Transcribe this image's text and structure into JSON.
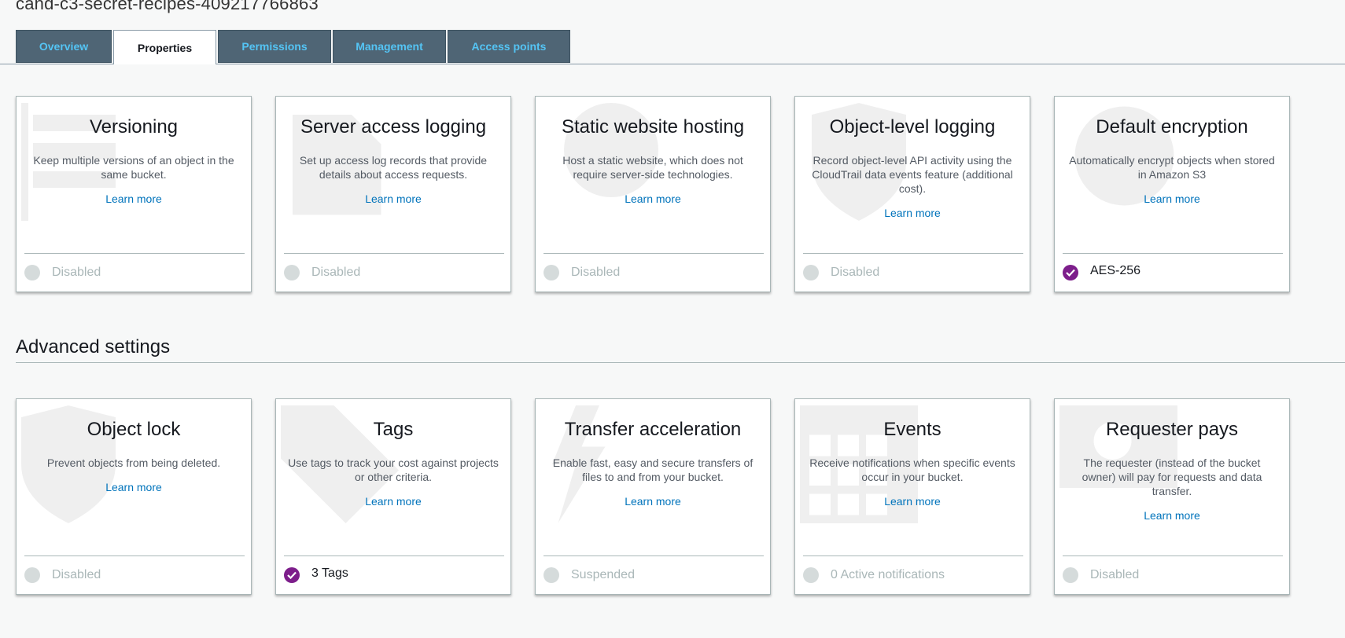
{
  "bucket_name": "cand-c3-secret-recipes-409217766863",
  "tabs": [
    {
      "label": "Overview",
      "active": false
    },
    {
      "label": "Properties",
      "active": true
    },
    {
      "label": "Permissions",
      "active": false
    },
    {
      "label": "Management",
      "active": false
    },
    {
      "label": "Access points",
      "active": false
    }
  ],
  "properties_cards": [
    {
      "title": "Versioning",
      "description": "Keep multiple versions of an object in the same bucket.",
      "learn_more": "Learn more",
      "status": "Disabled",
      "enabled": false,
      "icon": "versioning-icon"
    },
    {
      "title": "Server access logging",
      "description": "Set up access log records that provide details about access requests.",
      "learn_more": "Learn more",
      "status": "Disabled",
      "enabled": false,
      "icon": "logging-icon"
    },
    {
      "title": "Static website hosting",
      "description": "Host a static website, which does not require server-side technologies.",
      "learn_more": "Learn more",
      "status": "Disabled",
      "enabled": false,
      "icon": "globe-icon"
    },
    {
      "title": "Object-level logging",
      "description": "Record object-level API activity using the CloudTrail data events feature (additional cost).",
      "learn_more": "Learn more",
      "status": "Disabled",
      "enabled": false,
      "icon": "shield-icon"
    },
    {
      "title": "Default encryption",
      "description": "Automatically encrypt objects when stored in Amazon S3",
      "learn_more": "Learn more",
      "status": "AES-256",
      "enabled": true,
      "icon": "encryption-icon"
    }
  ],
  "advanced_section_title": "Advanced settings",
  "advanced_cards": [
    {
      "title": "Object lock",
      "description": "Prevent objects from being deleted.",
      "learn_more": "Learn more",
      "status": "Disabled",
      "enabled": false,
      "icon": "lock-shield-icon"
    },
    {
      "title": "Tags",
      "description": "Use tags to track your cost against projects or other criteria.",
      "learn_more": "Learn more",
      "status": "3 Tags",
      "enabled": true,
      "icon": "tag-icon"
    },
    {
      "title": "Transfer acceleration",
      "description": "Enable fast, easy and secure transfers of files to and from your bucket.",
      "learn_more": "Learn more",
      "status": "Suspended",
      "enabled": false,
      "icon": "lightning-icon"
    },
    {
      "title": "Events",
      "description": "Receive notifications when specific events occur in your bucket.",
      "learn_more": "Learn more",
      "status": "0 Active notifications",
      "enabled": false,
      "icon": "calendar-icon"
    },
    {
      "title": "Requester pays",
      "description": "The requester (instead of the bucket owner) will pay for requests and data transfer.",
      "learn_more": "Learn more",
      "status": "Disabled",
      "enabled": false,
      "icon": "dollar-bill-icon"
    }
  ]
}
